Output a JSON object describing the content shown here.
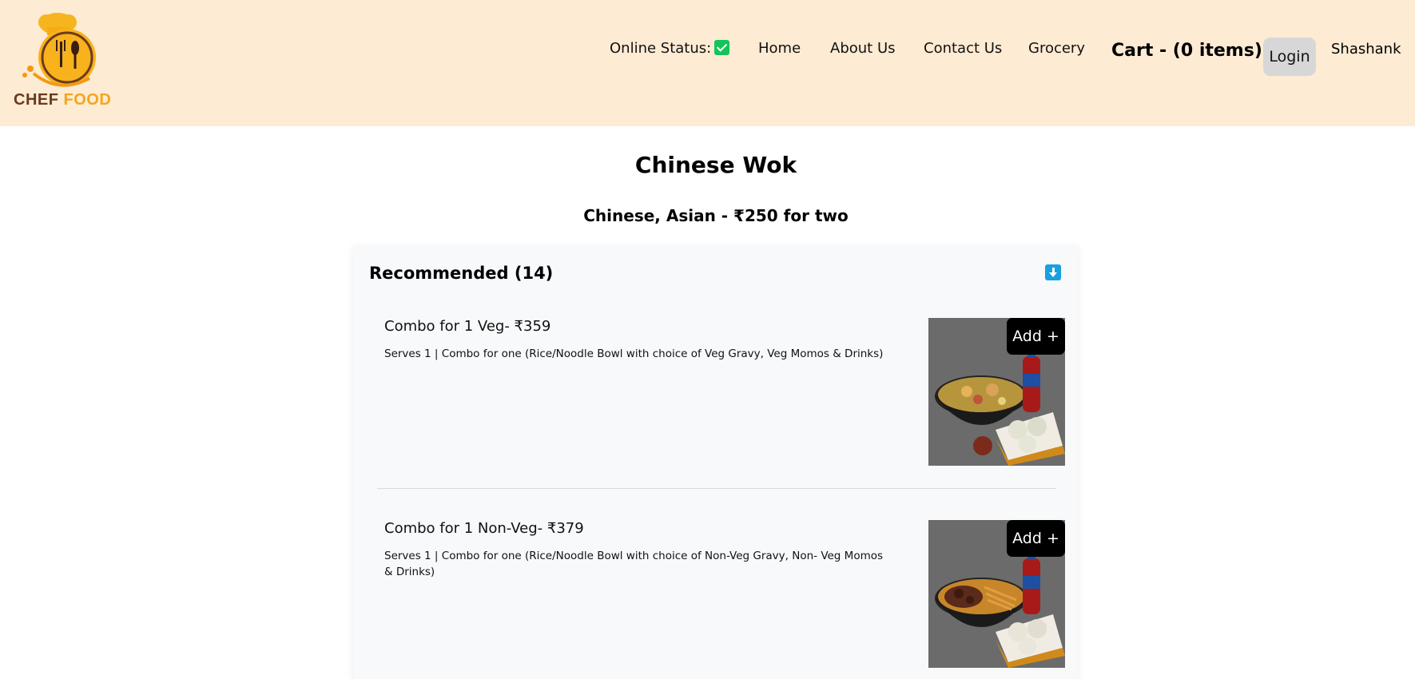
{
  "header": {
    "logo": {
      "text_chef": "CHEF",
      "text_food": "FOOD"
    },
    "online_status_label": "Online Status:",
    "online_status_icon": "check-icon",
    "nav": {
      "home": "Home",
      "about": "About Us",
      "contact": "Contact Us",
      "grocery": "Grocery"
    },
    "cart_label": "Cart - (0 items)",
    "login_label": "Login",
    "user_name": "Shashank",
    "colors": {
      "background": "#fdebd3",
      "status_green": "#16c35b"
    }
  },
  "restaurant": {
    "name": "Chinese Wok",
    "meta": "Chinese, Asian - ₹250 for two"
  },
  "category": {
    "title": "Recommended (14)",
    "toggle_icon": "arrow-down-icon",
    "items": [
      {
        "name": "Combo for 1 Veg- ₹359",
        "description": "Serves 1 | Combo for one (Rice/Noodle Bowl with choice of Veg Gravy, Veg Momos & Drinks)",
        "add_label": "Add +"
      },
      {
        "name": "Combo for 1 Non-Veg- ₹379",
        "description": "Serves 1 | Combo for one (Rice/Noodle Bowl with choice of Non-Veg Gravy, Non- Veg Momos & Drinks)",
        "add_label": "Add +"
      }
    ]
  }
}
